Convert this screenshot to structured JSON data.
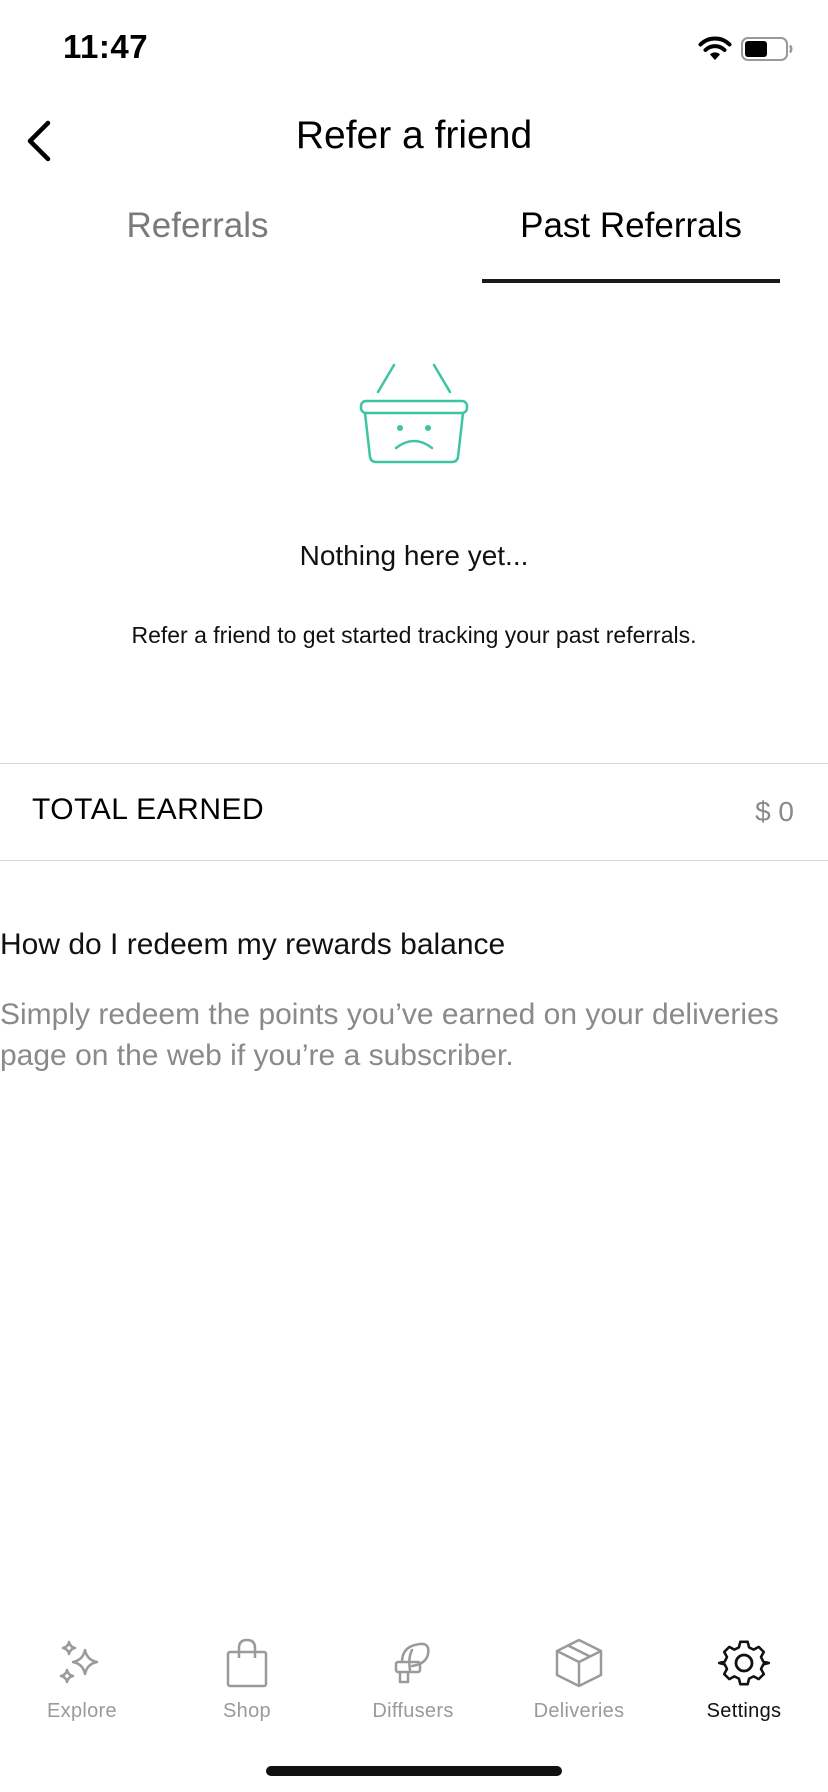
{
  "status_bar": {
    "time": "11:47"
  },
  "header": {
    "title": "Refer a friend"
  },
  "tabs": [
    {
      "label": "Referrals",
      "active": false
    },
    {
      "label": "Past Referrals",
      "active": true
    }
  ],
  "empty_state": {
    "icon": "sad-basket-icon",
    "title": "Nothing here yet...",
    "description": "Refer a friend to get started tracking your past referrals."
  },
  "total": {
    "label": "TOTAL EARNED",
    "value": "$ 0"
  },
  "faq": {
    "question": "How do I redeem my rewards balance",
    "answer": "Simply redeem the points you’ve earned on your deliveries page on the web if you’re a subscriber."
  },
  "tab_bar": {
    "items": [
      {
        "label": "Explore",
        "icon": "sparkles-icon",
        "active": false
      },
      {
        "label": "Shop",
        "icon": "shopping-bag-icon",
        "active": false
      },
      {
        "label": "Diffusers",
        "icon": "diffuser-icon",
        "active": false
      },
      {
        "label": "Deliveries",
        "icon": "box-icon",
        "active": false
      },
      {
        "label": "Settings",
        "icon": "gear-icon",
        "active": true
      }
    ]
  },
  "colors": {
    "accent": "#3fc4a3",
    "inactive": "#9a9a9a",
    "divider": "#d6d6d6"
  }
}
